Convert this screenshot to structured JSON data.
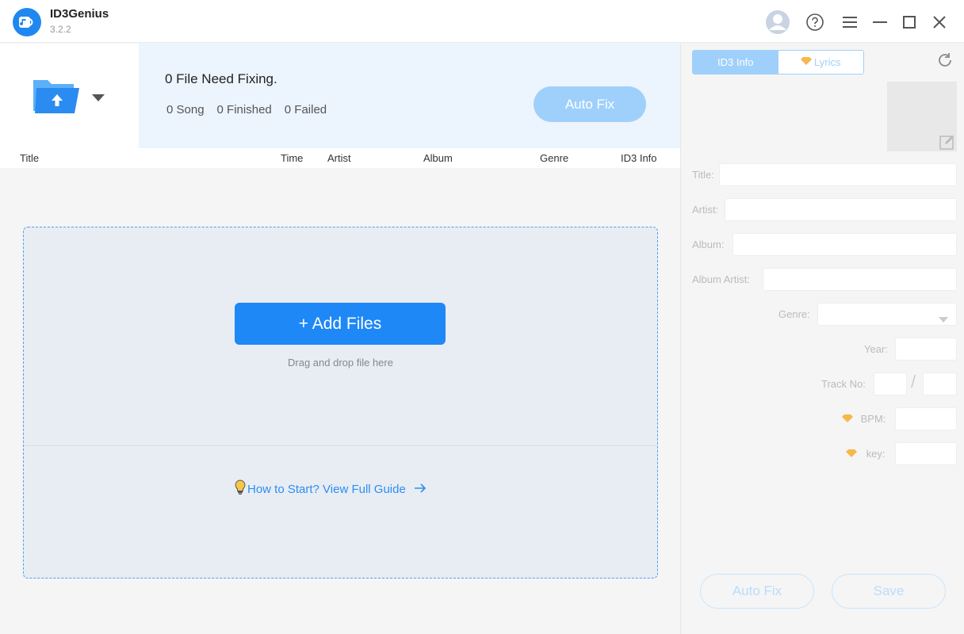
{
  "app": {
    "name": "ID3Genius",
    "version": "3.2.2"
  },
  "status": {
    "title": "0 File Need Fixing.",
    "song": "0 Song",
    "finished": "0 Finished",
    "failed": "0 Failed",
    "auto_fix_label": "Auto Fix"
  },
  "table": {
    "columns": [
      "Title",
      "Time",
      "Artist",
      "Album",
      "Genre",
      "ID3 Info"
    ]
  },
  "dropzone": {
    "add_files_label": "+ Add Files",
    "hint": "Drag and drop file here",
    "guide": "How to Start? View Full Guide"
  },
  "right_panel": {
    "tabs": [
      "ID3 Info",
      "Lyrics"
    ],
    "fields": {
      "title": "Title:",
      "artist": "Artist:",
      "album": "Album:",
      "album_artist": "Album Artist:",
      "genre": "Genre:",
      "year": "Year:",
      "track_no": "Track No:",
      "track_sep": "/",
      "bpm": "BPM:",
      "key": "key:"
    },
    "auto_fix_label": "Auto Fix",
    "save_label": "Save"
  },
  "colors": {
    "accent": "#1e88f6",
    "accent_light": "#9fd0fb",
    "premium": "#f6b84b"
  },
  "icons": {
    "logo": "music-note-icon",
    "avatar": "user-avatar-icon",
    "help": "question-circle-icon",
    "menu": "hamburger-menu-icon",
    "minimize": "minimize-icon",
    "maximize": "maximize-icon",
    "close": "close-icon"
  }
}
